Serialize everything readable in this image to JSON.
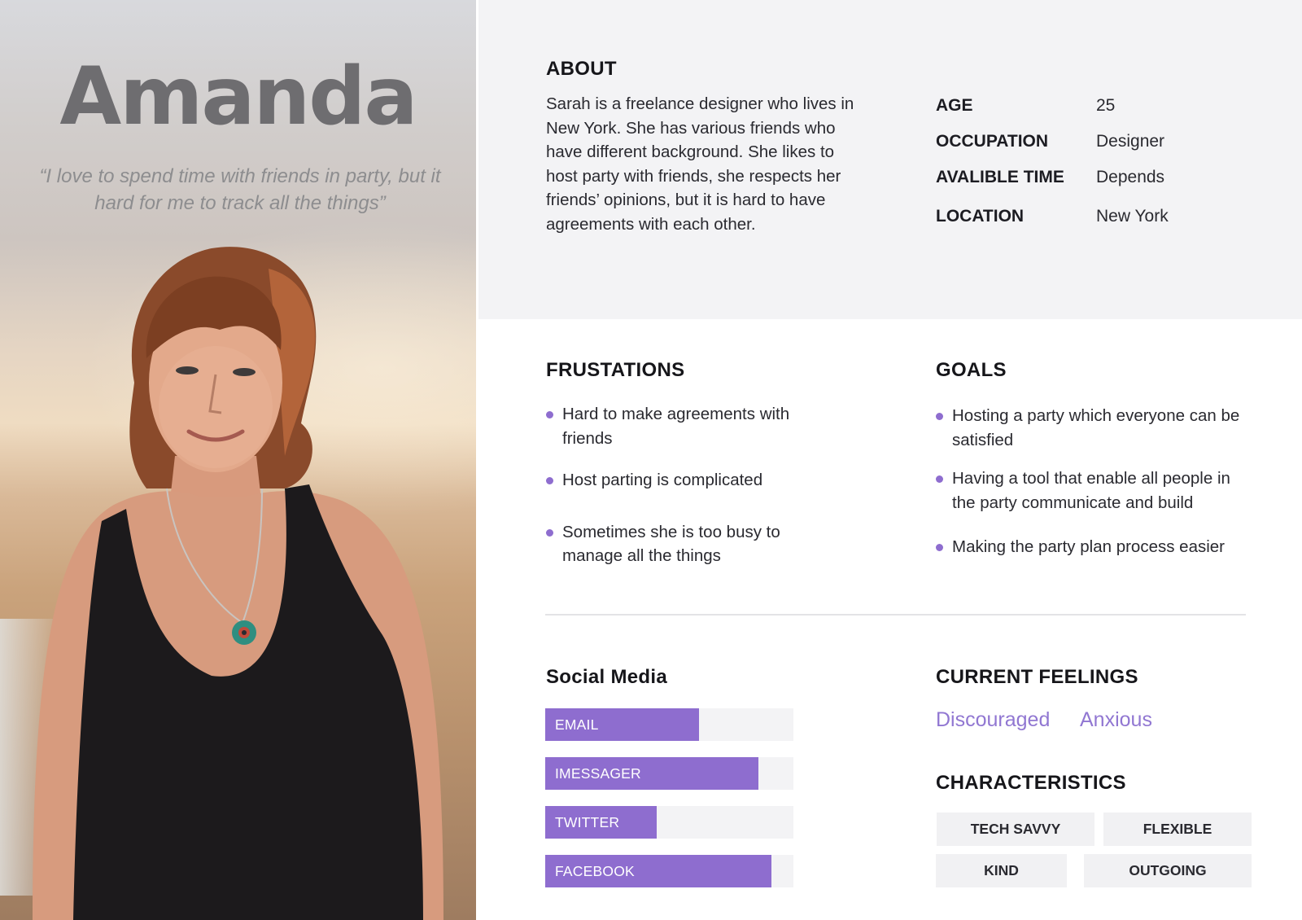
{
  "persona": {
    "name": "Amanda",
    "quote": "“I love to spend time with friends in party, but it hard for me to track all the things”"
  },
  "about": {
    "title": "ABOUT",
    "text": "Sarah is a freelance designer who lives in New York. She has various friends who have different background. She likes to host party with friends, she respects her friends’ opinions, but it is hard to have agreements with each other.",
    "facts": [
      {
        "key": "AGE",
        "value": "25"
      },
      {
        "key": "OCCUPATION",
        "value": "Designer"
      },
      {
        "key": "AVALIBLE TIME",
        "value": "Depends"
      },
      {
        "key": "LOCATION",
        "value": "New York"
      }
    ]
  },
  "frustrations": {
    "title": "FRUSTATIONS",
    "items": [
      "Hard to make agreements with friends",
      "Host parting is complicated",
      "Sometimes she is too busy to manage all the things"
    ]
  },
  "goals": {
    "title": "GOALS",
    "items": [
      "Hosting a party which everyone can be satisfied",
      "Having a tool that enable all people in the party communicate and build",
      "Making the party plan process easier"
    ]
  },
  "social_media": {
    "title": "Social Media",
    "items": [
      {
        "label": "EMAIL",
        "level": 0.62
      },
      {
        "label": "IMESSAGER",
        "level": 0.86
      },
      {
        "label": "TWITTER",
        "level": 0.45
      },
      {
        "label": "FACEBOOK",
        "level": 0.91
      }
    ]
  },
  "feelings": {
    "title": "CURRENT FEELINGS",
    "items": [
      "Discouraged",
      "Anxious"
    ]
  },
  "characteristics": {
    "title": "CHARACTERISTICS",
    "items": [
      "TECH SAVVY",
      "FLEXIBLE",
      "KIND",
      "OUTGOING"
    ]
  },
  "colors": {
    "accent": "#8e6dcf",
    "feeling_text": "#9177d2",
    "panel_bg": "#f3f3f5"
  }
}
